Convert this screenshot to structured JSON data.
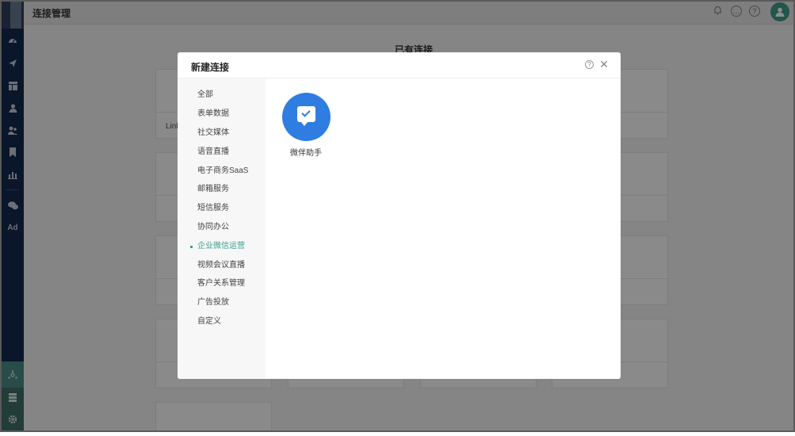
{
  "header": {
    "title": "连接管理"
  },
  "nav": {
    "items": [
      "dashboard-icon",
      "send-icon",
      "layout-icon",
      "user-icon",
      "users-icon",
      "bookmark-icon",
      "chart-icon",
      "wechat-icon"
    ],
    "ad_label": "Ad",
    "bottom": [
      "connection-icon",
      "list-icon",
      "gear-icon"
    ]
  },
  "background": {
    "section_title": "已有连接",
    "card_text": "Link"
  },
  "modal": {
    "title": "新建连接",
    "categories": [
      {
        "label": "全部"
      },
      {
        "label": "表单数据"
      },
      {
        "label": "社交媒体"
      },
      {
        "label": "语音直播"
      },
      {
        "label": "电子商务SaaS"
      },
      {
        "label": "邮箱服务"
      },
      {
        "label": "短信服务"
      },
      {
        "label": "协同办公"
      },
      {
        "label": "企业微信运营",
        "active": true
      },
      {
        "label": "视频会议直播"
      },
      {
        "label": "客户关系管理"
      },
      {
        "label": "广告投放"
      },
      {
        "label": "自定义"
      }
    ],
    "apps": [
      {
        "label": "微伴助手",
        "color": "#2f7de1"
      }
    ]
  },
  "colors": {
    "nav": "#13294d",
    "accent": "#3aa08f",
    "app": "#2f7de1"
  }
}
